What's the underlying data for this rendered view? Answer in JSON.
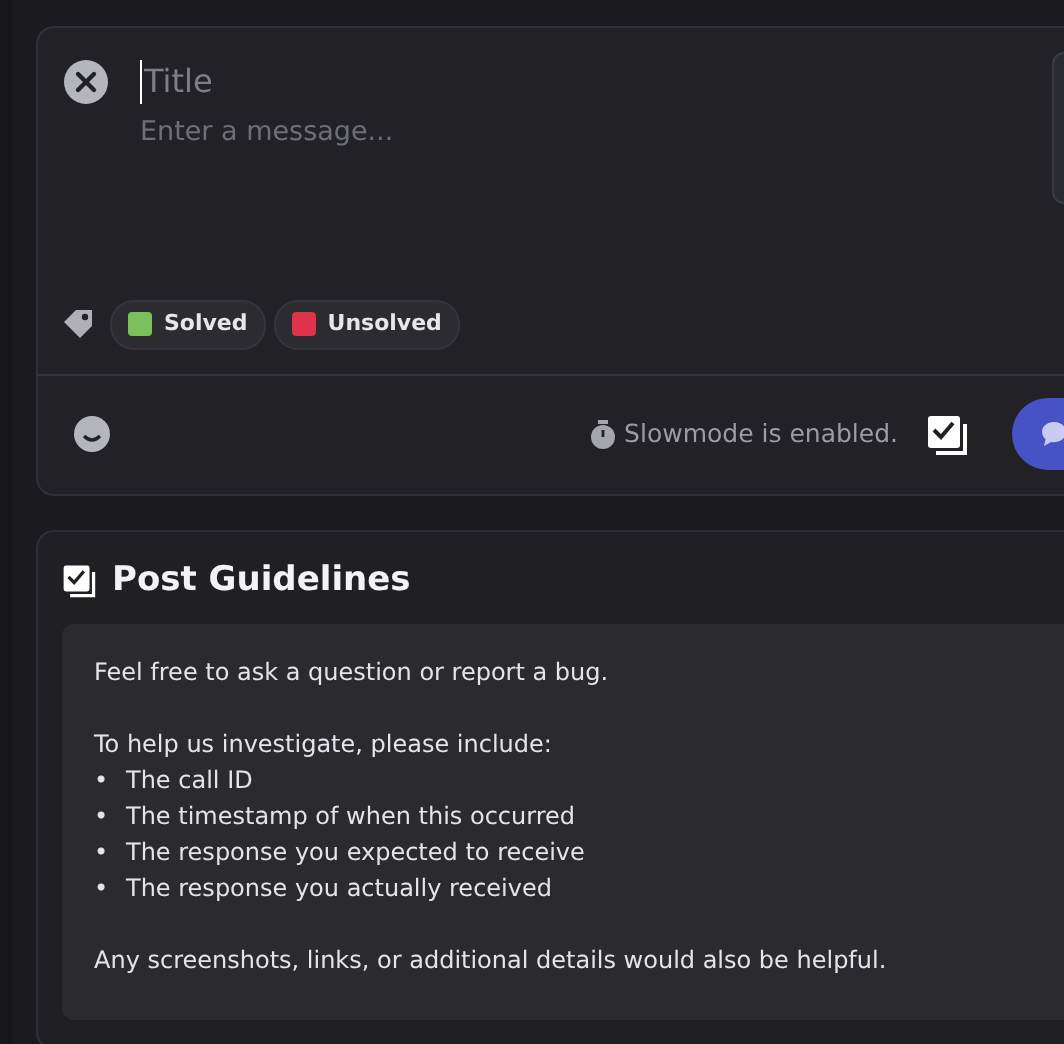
{
  "composer": {
    "title": {
      "placeholder": "Title"
    },
    "message": {
      "placeholder": "Enter a message..."
    },
    "tags": [
      {
        "label": "Solved",
        "color": "#7ac05c"
      },
      {
        "label": "Unsolved",
        "color": "#e0344a"
      }
    ],
    "slowmode": "Slowmode is enabled."
  },
  "guidelines": {
    "heading": "Post Guidelines",
    "intro": "Feel free to ask a question or report a bug.",
    "lead": "To help us investigate, please include:",
    "items": [
      {
        "marker": "•",
        "text": "The call ID"
      },
      {
        "marker": "•",
        "text": "The timestamp of when this occurred"
      },
      {
        "marker": "•",
        "text": "The response you expected to receive"
      },
      {
        "marker": "•",
        "text": "The response you actually received"
      }
    ],
    "outro": "Any screenshots, links, or additional details would also be helpful."
  }
}
